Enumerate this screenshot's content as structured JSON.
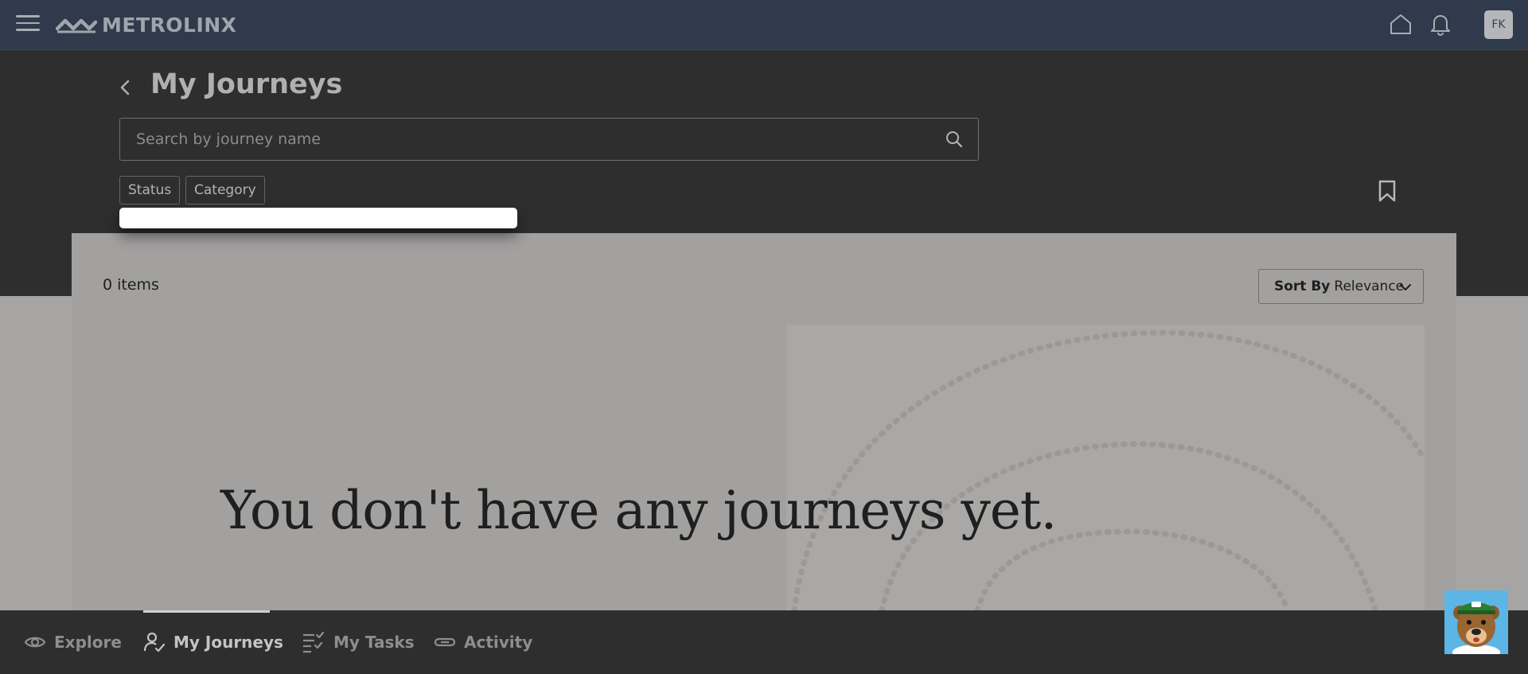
{
  "header": {
    "logo_text": "METROLINX",
    "avatar_initials": "FK"
  },
  "page": {
    "title": "My Journeys",
    "search_placeholder": "Search by journey name",
    "filters": [
      "Status",
      "Category"
    ]
  },
  "results": {
    "count_text": "0 items",
    "sort_label": "Sort By",
    "sort_value": "Relevance",
    "empty_message": "You don't have any journeys yet."
  },
  "bottom_nav": {
    "items": [
      {
        "label": "Explore",
        "icon": "eye-icon",
        "active": false
      },
      {
        "label": "My Journeys",
        "icon": "person-check-icon",
        "active": true
      },
      {
        "label": "My Tasks",
        "icon": "checklist-icon",
        "active": false
      },
      {
        "label": "Activity",
        "icon": "link-icon",
        "active": false
      }
    ]
  },
  "colors": {
    "header_bg": "#2f3a4c",
    "dark_band": "#2e2e2e",
    "content_bg": "#a2a1a0",
    "avatar_bg": "#b4b6b9"
  }
}
